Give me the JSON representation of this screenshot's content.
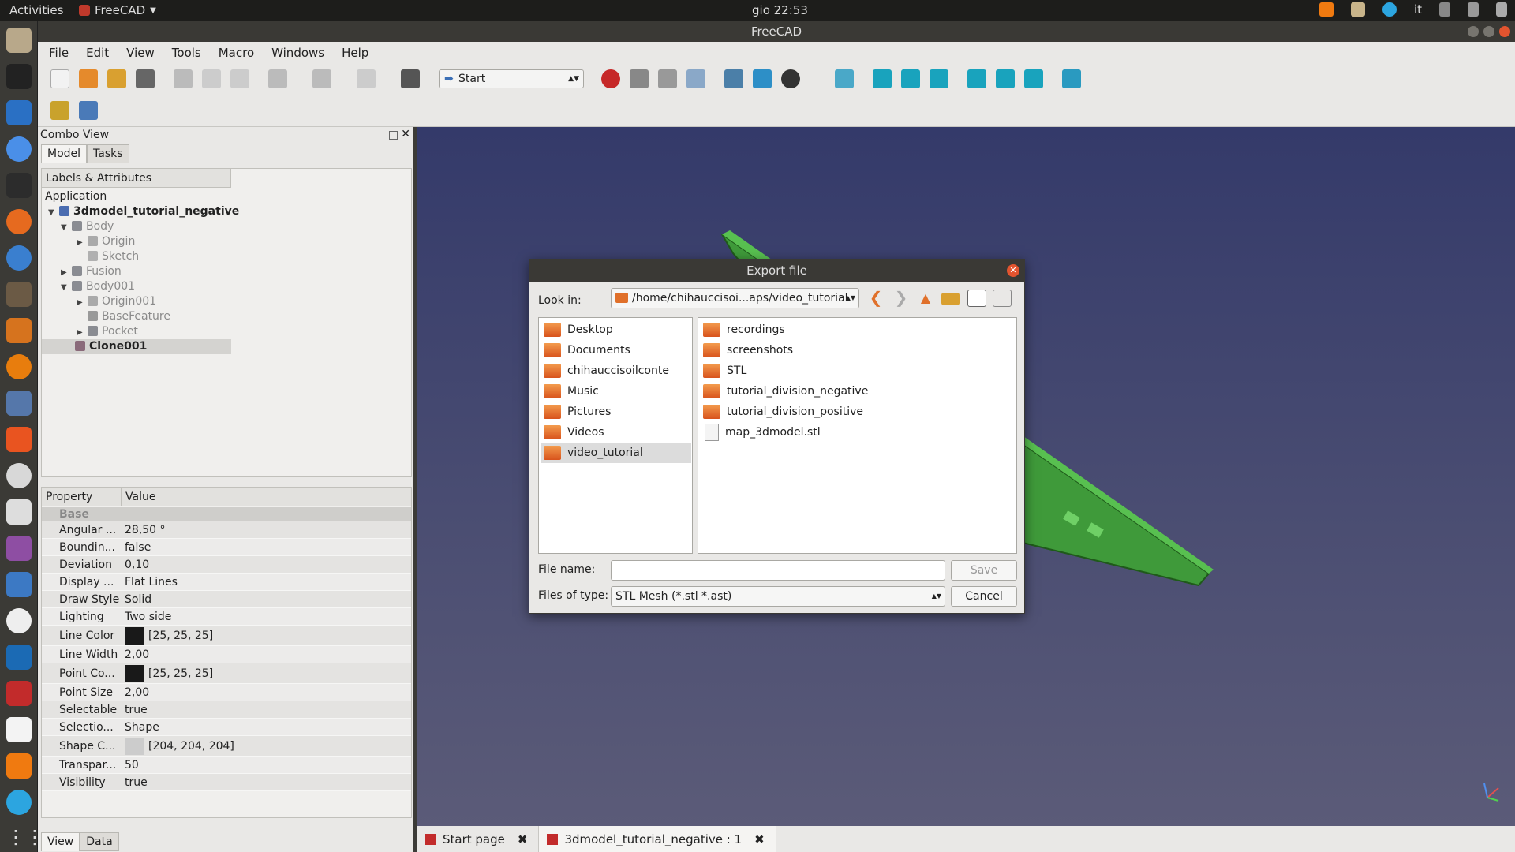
{
  "system": {
    "activities": "Activities",
    "app_name": "FreeCAD",
    "clock": "gio 22:53",
    "keyboard_layout": "it"
  },
  "window": {
    "title": "FreeCAD"
  },
  "menu": [
    "File",
    "Edit",
    "View",
    "Tools",
    "Macro",
    "Windows",
    "Help"
  ],
  "toolbar": {
    "workbench": "Start"
  },
  "combo_view": {
    "title": "Combo View",
    "tabs": [
      "Model",
      "Tasks"
    ],
    "tree_header": "Labels & Attributes",
    "tree": {
      "application": "Application",
      "items": [
        {
          "label": "3dmodel_tutorial_negative"
        },
        {
          "label": "Body"
        },
        {
          "label": "Origin"
        },
        {
          "label": "Sketch"
        },
        {
          "label": "Fusion"
        },
        {
          "label": "Body001"
        },
        {
          "label": "Origin001"
        },
        {
          "label": "BaseFeature"
        },
        {
          "label": "Pocket"
        },
        {
          "label": "Clone001"
        }
      ]
    },
    "property_header": {
      "property": "Property",
      "value": "Value"
    },
    "group": "Base",
    "properties": [
      {
        "name": "Angular ...",
        "value": "28,50 °"
      },
      {
        "name": "Boundin...",
        "value": "false"
      },
      {
        "name": "Deviation",
        "value": "0,10"
      },
      {
        "name": "Display ...",
        "value": "Flat Lines"
      },
      {
        "name": "Draw Style",
        "value": "Solid"
      },
      {
        "name": "Lighting",
        "value": "Two side"
      },
      {
        "name": "Line Color",
        "value": "[25, 25, 25]",
        "swatch": "#191919"
      },
      {
        "name": "Line Width",
        "value": "2,00"
      },
      {
        "name": "Point Co...",
        "value": "[25, 25, 25]",
        "swatch": "#191919"
      },
      {
        "name": "Point Size",
        "value": "2,00"
      },
      {
        "name": "Selectable",
        "value": "true"
      },
      {
        "name": "Selectio...",
        "value": "Shape"
      },
      {
        "name": "Shape C...",
        "value": "[204, 204, 204]",
        "swatch": "#cccccc"
      },
      {
        "name": "Transpar...",
        "value": "50"
      },
      {
        "name": "Visibility",
        "value": "true"
      }
    ],
    "bottom_tabs": [
      "View",
      "Data"
    ]
  },
  "doc_tabs": [
    "Start page",
    "3dmodel_tutorial_negative : 1"
  ],
  "dialog": {
    "title": "Export file",
    "look_in_label": "Look in:",
    "path": "/home/chihauccisoi...aps/video_tutorial",
    "places": [
      "Desktop",
      "Documents",
      "chihauccisoilconte",
      "Music",
      "Pictures",
      "Videos",
      "video_tutorial"
    ],
    "entries": [
      {
        "name": "recordings",
        "type": "folder"
      },
      {
        "name": "screenshots",
        "type": "folder"
      },
      {
        "name": "STL",
        "type": "folder"
      },
      {
        "name": "tutorial_division_negative",
        "type": "folder"
      },
      {
        "name": "tutorial_division_positive",
        "type": "folder"
      },
      {
        "name": "map_3dmodel.stl",
        "type": "file"
      }
    ],
    "file_name_label": "File name:",
    "file_name_value": "",
    "file_type_label": "Files of type:",
    "file_type": "STL Mesh (*.stl *.ast)",
    "save": "Save",
    "cancel": "Cancel"
  },
  "colors": {
    "accent": "#e2542f",
    "model_green": "#3f9a3a",
    "viewport_top": "#343a6a",
    "viewport_bottom": "#5b5b78"
  }
}
